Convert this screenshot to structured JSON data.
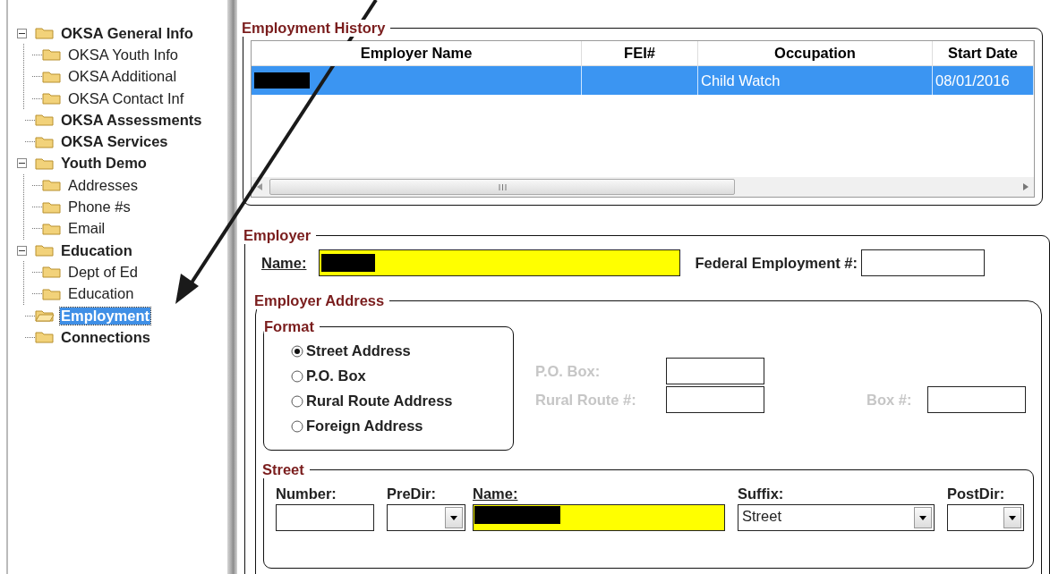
{
  "tree": [
    {
      "label": "OKSA General Info",
      "expanded": true,
      "selected": false,
      "children": [
        {
          "label": "OKSA Youth Info",
          "selected": false
        },
        {
          "label": "OKSA Additional",
          "selected": false
        },
        {
          "label": "OKSA Contact Inf",
          "selected": false
        }
      ]
    },
    {
      "label": "OKSA Assessments",
      "selected": false
    },
    {
      "label": "OKSA Services",
      "selected": false
    },
    {
      "label": "Youth Demo",
      "expanded": true,
      "selected": false,
      "children": [
        {
          "label": "Addresses",
          "selected": false
        },
        {
          "label": "Phone #s",
          "selected": false
        },
        {
          "label": "Email",
          "selected": false
        }
      ]
    },
    {
      "label": "Education",
      "expanded": true,
      "selected": false,
      "children": [
        {
          "label": "Dept of Ed",
          "selected": false
        },
        {
          "label": "Education",
          "selected": false
        }
      ]
    },
    {
      "label": "Employment",
      "selected": true
    },
    {
      "label": "Connections",
      "selected": false
    }
  ],
  "history": {
    "title": "Employment History",
    "columns": [
      "Employer Name",
      "FEI#",
      "Occupation",
      "Start Date"
    ],
    "rows": [
      {
        "selected": true,
        "cells": [
          {
            "text": "",
            "redacted": true
          },
          {
            "text": ""
          },
          {
            "text": "Child Watch"
          },
          {
            "text": "08/01/2016"
          }
        ]
      }
    ]
  },
  "employer": {
    "title": "Employer",
    "name_label": "Name:",
    "name_redacted": true,
    "fei_label": "Federal Employment #:",
    "address": {
      "title": "Employer Address",
      "format_title": "Format",
      "formats": [
        {
          "label": "Street Address",
          "selected": true
        },
        {
          "label": "P.O. Box",
          "selected": false
        },
        {
          "label": "Rural Route Address",
          "selected": false
        },
        {
          "label": "Foreign Address",
          "selected": false
        }
      ],
      "po_box_label": "P.O. Box:",
      "rural_route_label": "Rural Route #:",
      "box_label": "Box #:",
      "disabled": true,
      "street": {
        "title": "Street",
        "number_label": "Number:",
        "predir_label": "PreDir:",
        "name_label": "Name:",
        "name_redacted": true,
        "suffix_label": "Suffix:",
        "suffix_value": "Street",
        "postdir_label": "PostDir:"
      }
    }
  }
}
